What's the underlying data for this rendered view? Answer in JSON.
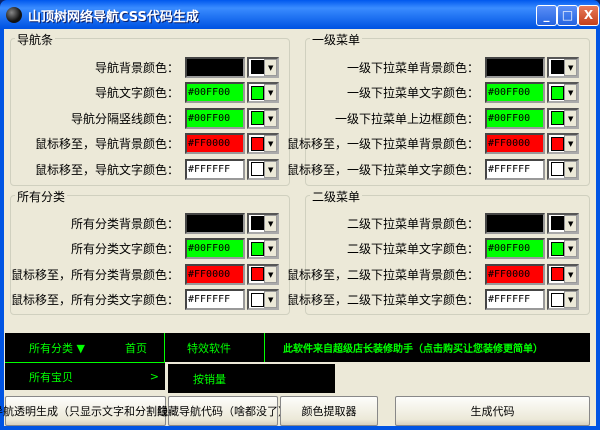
{
  "window": {
    "title": "山顶树网络导航CSS代码生成",
    "minimize": "_",
    "maximize": "□",
    "close": "X"
  },
  "groups": [
    {
      "title": "导航条",
      "rows": [
        {
          "label": "导航背景颜色：",
          "value": "",
          "color": "#000000"
        },
        {
          "label": "导航文字颜色：",
          "value": "#00FF00",
          "color": "#00FF00"
        },
        {
          "label": "导航分隔竖线颜色：",
          "value": "#00FF00",
          "color": "#00FF00"
        },
        {
          "label": "鼠标移至，导航背景颜色：",
          "value": "#FF0000",
          "color": "#FF0000"
        },
        {
          "label": "鼠标移至，导航文字颜色：",
          "value": "#FFFFFF",
          "color": "#FFFFFF"
        }
      ]
    },
    {
      "title": "一级菜单",
      "rows": [
        {
          "label": "一级下拉菜单背景颜色：",
          "value": "",
          "color": "#000000"
        },
        {
          "label": "一级下拉菜单文字颜色：",
          "value": "#00FF00",
          "color": "#00FF00"
        },
        {
          "label": "一级下拉菜单上边框颜色：",
          "value": "#00FF00",
          "color": "#00FF00"
        },
        {
          "label": "鼠标移至，一级下拉菜单背景颜色：",
          "value": "#FF0000",
          "color": "#FF0000"
        },
        {
          "label": "鼠标移至，一级下拉菜单文字颜色：",
          "value": "#FFFFFF",
          "color": "#FFFFFF"
        }
      ]
    },
    {
      "title": "所有分类",
      "rows": [
        {
          "label": "所有分类背景颜色：",
          "value": "",
          "color": "#000000"
        },
        {
          "label": "所有分类文字颜色：",
          "value": "#00FF00",
          "color": "#00FF00"
        },
        {
          "label": "鼠标移至，所有分类背景颜色：",
          "value": "#FF0000",
          "color": "#FF0000"
        },
        {
          "label": "鼠标移至，所有分类文字颜色：",
          "value": "#FFFFFF",
          "color": "#FFFFFF"
        }
      ]
    },
    {
      "title": "二级菜单",
      "rows": [
        {
          "label": "二级下拉菜单背景颜色：",
          "value": "",
          "color": "#000000"
        },
        {
          "label": "二级下拉菜单文字颜色：",
          "value": "#00FF00",
          "color": "#00FF00"
        },
        {
          "label": "鼠标移至，二级下拉菜单背景颜色：",
          "value": "#FF0000",
          "color": "#FF0000"
        },
        {
          "label": "鼠标移至，二级下拉菜单文字颜色：",
          "value": "#FFFFFF",
          "color": "#FFFFFF"
        }
      ]
    }
  ],
  "preview": {
    "all_categories": "所有分类 ▼",
    "home": "首页",
    "effects": "特效软件",
    "promo": "此软件来自超级店长装修助手（点击购买让您装修更简单）",
    "all_items": "所有宝贝",
    "arrow": ">",
    "by_sales": "按销量"
  },
  "buttons": {
    "transparent": "导航透明生成（只显示文字和分割线）",
    "hide": "隐藏导航代码（啥都没了）",
    "picker": "颜色提取器",
    "generate": "生成代码"
  }
}
